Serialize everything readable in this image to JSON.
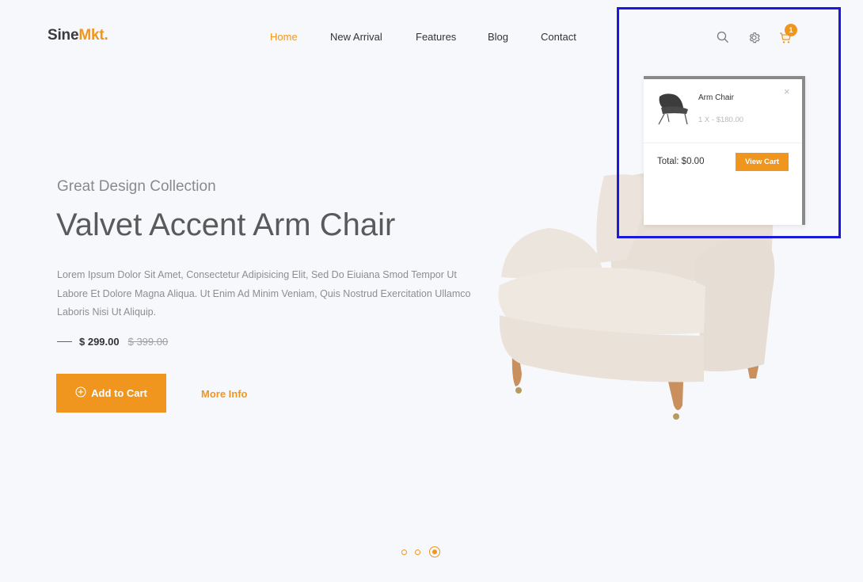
{
  "brand": {
    "name_part1": "Sine",
    "name_part2": "Mkt."
  },
  "nav": {
    "items": [
      "Home",
      "New Arrival",
      "Features",
      "Blog",
      "Contact"
    ],
    "active": "Home"
  },
  "header_icons": [
    "search-icon",
    "gear-icon",
    "cart-icon"
  ],
  "cart": {
    "count": "1"
  },
  "hero": {
    "subtitle": "Great Design Collection",
    "title": "Valvet Accent Arm Chair",
    "description": "Lorem Ipsum Dolor Sit Amet, Consectetur Adipisicing Elit, Sed Do Eiuiana Smod Tempor Ut Labore Et Dolore Magna Aliqua. Ut Enim Ad Minim Veniam, Quis Nostrud Exercitation Ullamco Laboris Nisi Ut Aliquip.",
    "price_current": "$ 299.00",
    "price_old": "$ 399.00",
    "add_to_cart_label": "Add to Cart",
    "more_info_label": "More Info"
  },
  "slider": {
    "count": 3,
    "active_index": 2
  },
  "cart_dropdown": {
    "item_name": "Arm Chair",
    "item_qty": "1 X - $180.00",
    "total_label": "Total: $0.00",
    "view_cart_label": "View Cart",
    "close_symbol": "×"
  },
  "colors": {
    "accent": "#f0961f",
    "text": "#333333",
    "background": "#f7f8fc",
    "highlight": "#1a1adc"
  }
}
